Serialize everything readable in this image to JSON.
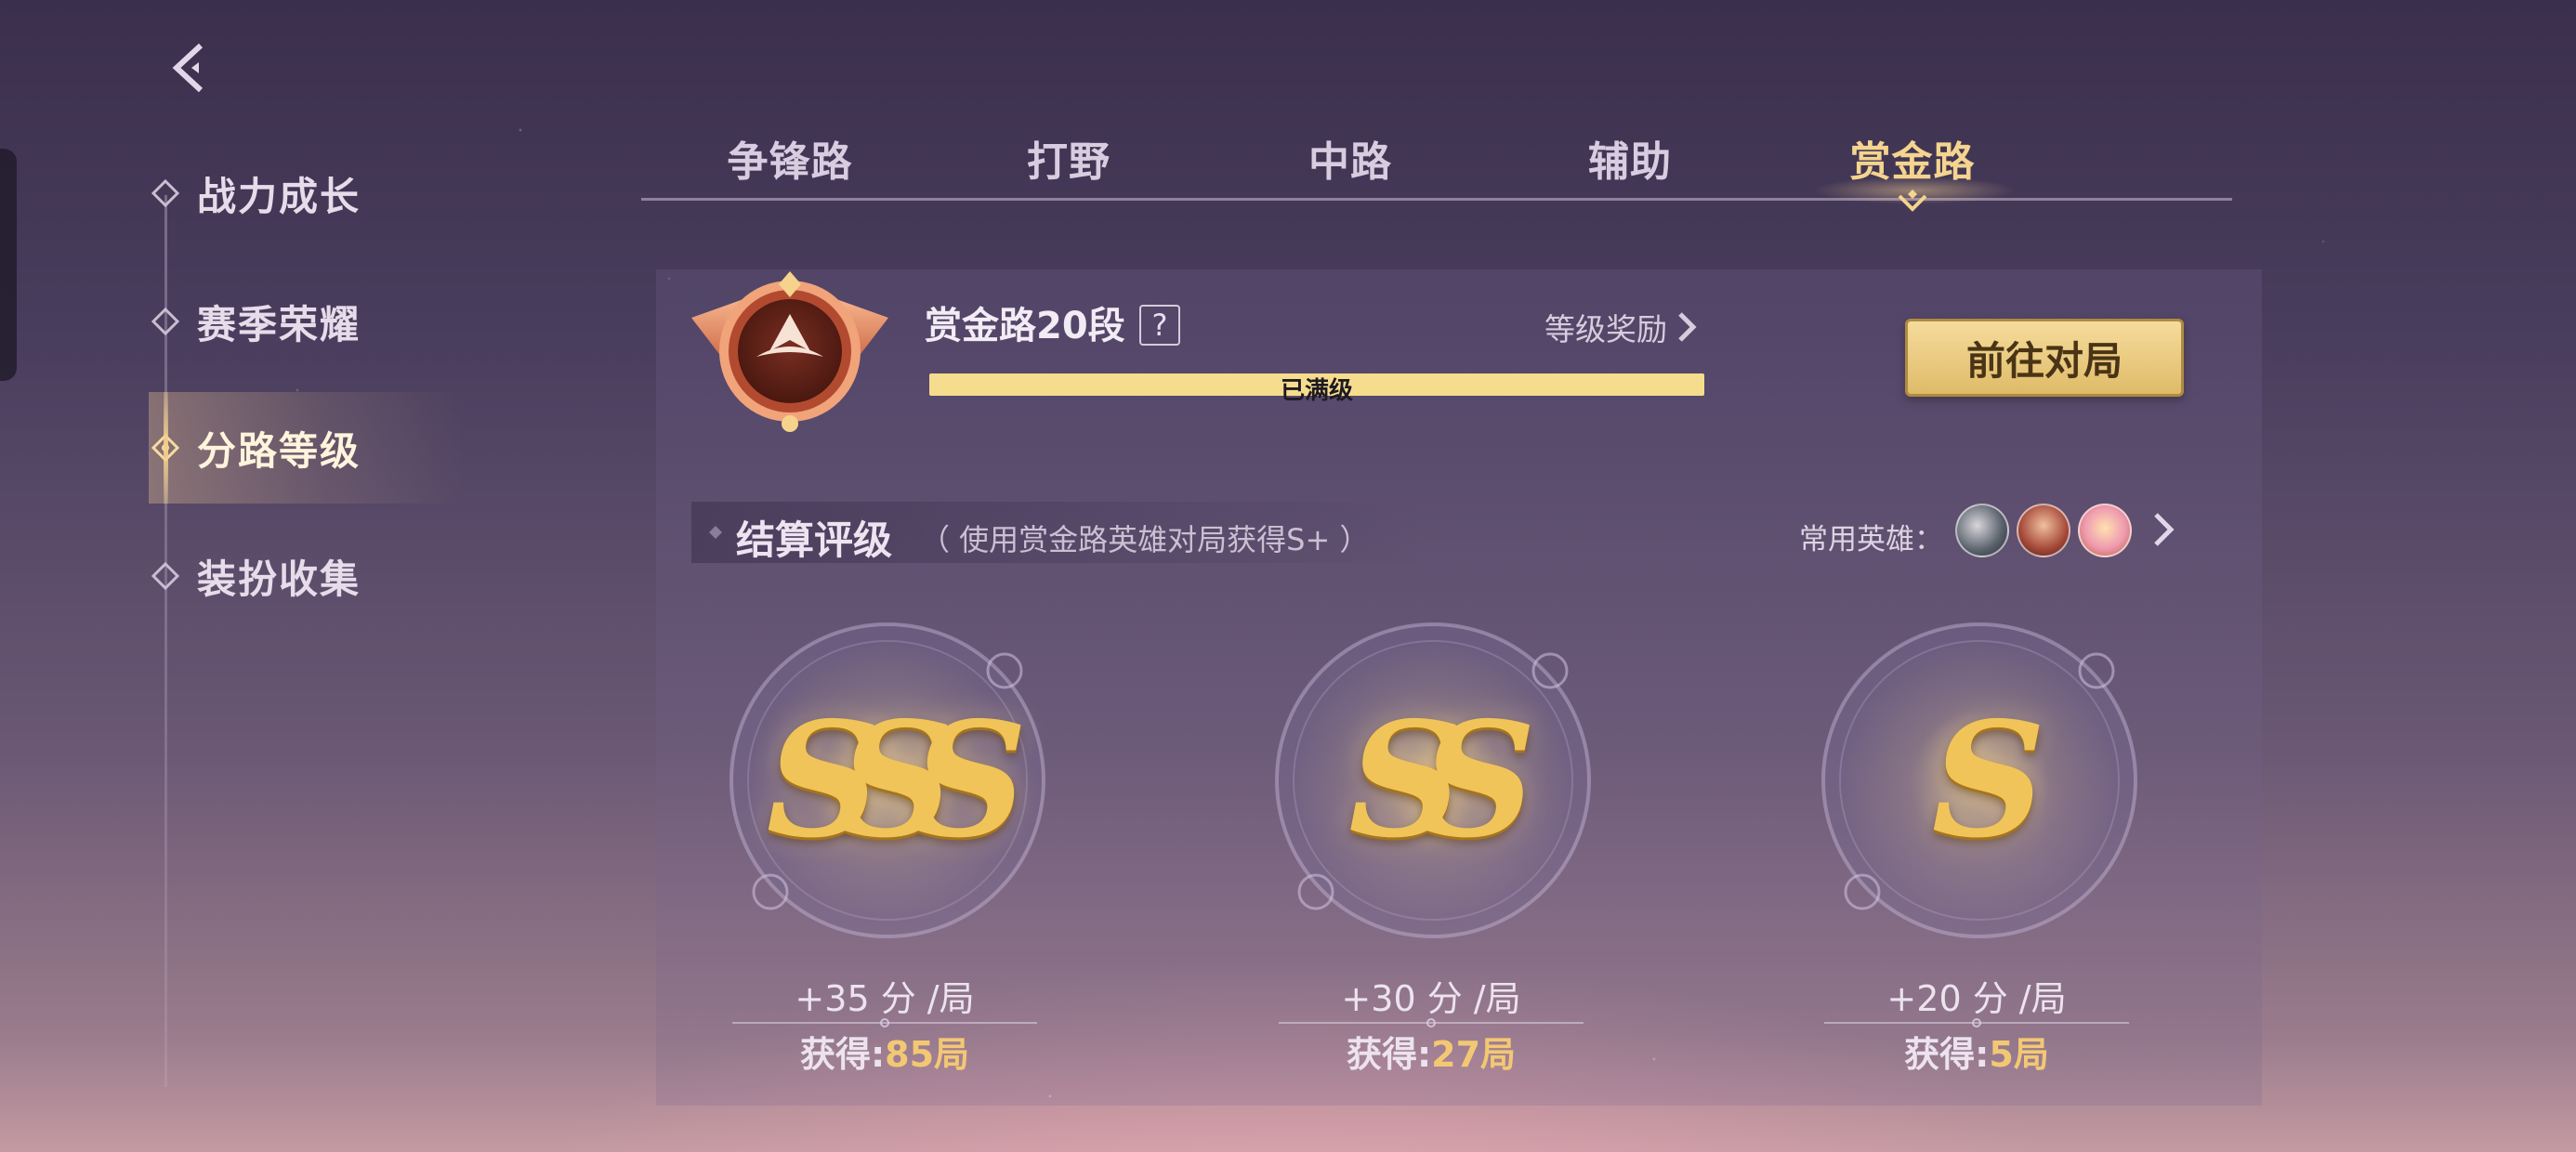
{
  "nav": {
    "back_icon": "chevron-left-icon"
  },
  "sidebar": {
    "items": [
      {
        "label": "战力成长",
        "active": false
      },
      {
        "label": "赛季荣耀",
        "active": false
      },
      {
        "label": "分路等级",
        "active": true
      },
      {
        "label": "装扮收集",
        "active": false
      }
    ]
  },
  "tabs": [
    {
      "label": "争锋路",
      "active": false
    },
    {
      "label": "打野",
      "active": false
    },
    {
      "label": "中路",
      "active": false
    },
    {
      "label": "辅助",
      "active": false
    },
    {
      "label": "赏金路",
      "active": true
    }
  ],
  "rank": {
    "title": "赏金路20段",
    "help": "?",
    "reward_link": "等级奖励",
    "progress_text": "已满级",
    "progress_fraction": 1.0,
    "go_button": "前往对局"
  },
  "settlement": {
    "title": "结算评级",
    "note": "（ 使用赏金路英雄对局获得S+ ）",
    "favorite_heroes_label": "常用英雄：",
    "favorite_heroes": [
      "hero-avatar-1",
      "hero-avatar-2",
      "hero-avatar-3"
    ],
    "grades": [
      {
        "grade": "SSS",
        "score": "+35 分 /局",
        "earned_label": "获得:",
        "earned_value": "85局"
      },
      {
        "grade": "SS",
        "score": "+30 分 /局",
        "earned_label": "获得:",
        "earned_value": "27局"
      },
      {
        "grade": "S",
        "score": "+20 分 /局",
        "earned_label": "获得:",
        "earned_value": "5局"
      }
    ]
  },
  "colors": {
    "accent_gold": "#f4d48e",
    "progress_fill": "#f6dc8d",
    "count_gold": "#f3c873"
  }
}
